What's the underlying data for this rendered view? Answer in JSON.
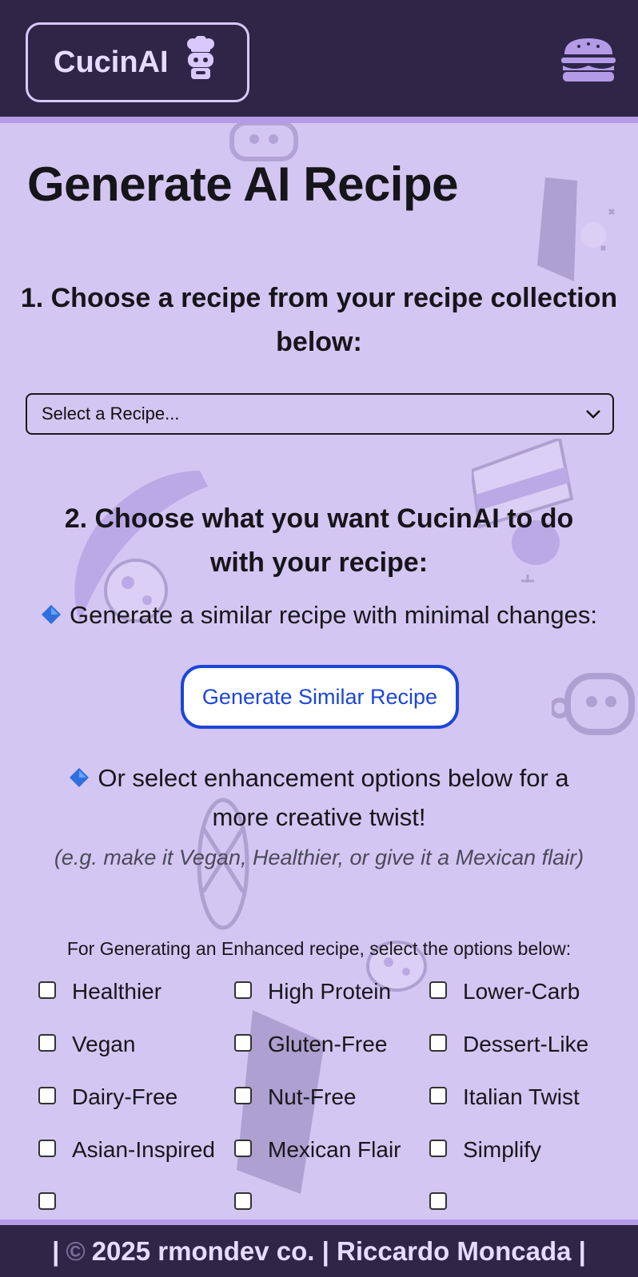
{
  "header": {
    "brand": "CucinAI",
    "logo_icon": "chef-robot-icon",
    "menu_icon": "hamburger-menu-icon"
  },
  "main": {
    "title": "Generate AI Recipe",
    "step1": "1. Choose a recipe from your recipe collection below:",
    "select": {
      "value": "Select a Recipe...",
      "icon": "chevron-down-icon"
    },
    "step2": "2. Choose what you want CucinAI to do with your recipe:",
    "similar_text": "Generate a similar recipe with minimal changes:",
    "similar_button": "Generate Similar Recipe",
    "enhance_text": "Or select enhancement options below for a more creative twist!",
    "enhance_hint": "(e.g. make it Vegan, Healthier, or give it a Mexican flair)",
    "options_title": "For Generating an Enhanced recipe, select the options below:",
    "options": [
      "Healthier",
      "High Protein",
      "Lower-Carb",
      "Vegan",
      "Gluten-Free",
      "Dessert-Like",
      "Dairy-Free",
      "Nut-Free",
      "Italian Twist",
      "Asian-Inspired",
      "Mexican Flair",
      "Simplify"
    ],
    "bullet_icon": "blue-diamond-icon"
  },
  "footer": {
    "prefix": "|",
    "copyright_symbol": "©",
    "text": "2025 rmondev co. | Riccardo Moncada |"
  },
  "colors": {
    "header_bg": "#2f2647",
    "page_bg": "#d4c6f2",
    "accent": "#b49be8",
    "button_blue": "#1c46d6"
  }
}
